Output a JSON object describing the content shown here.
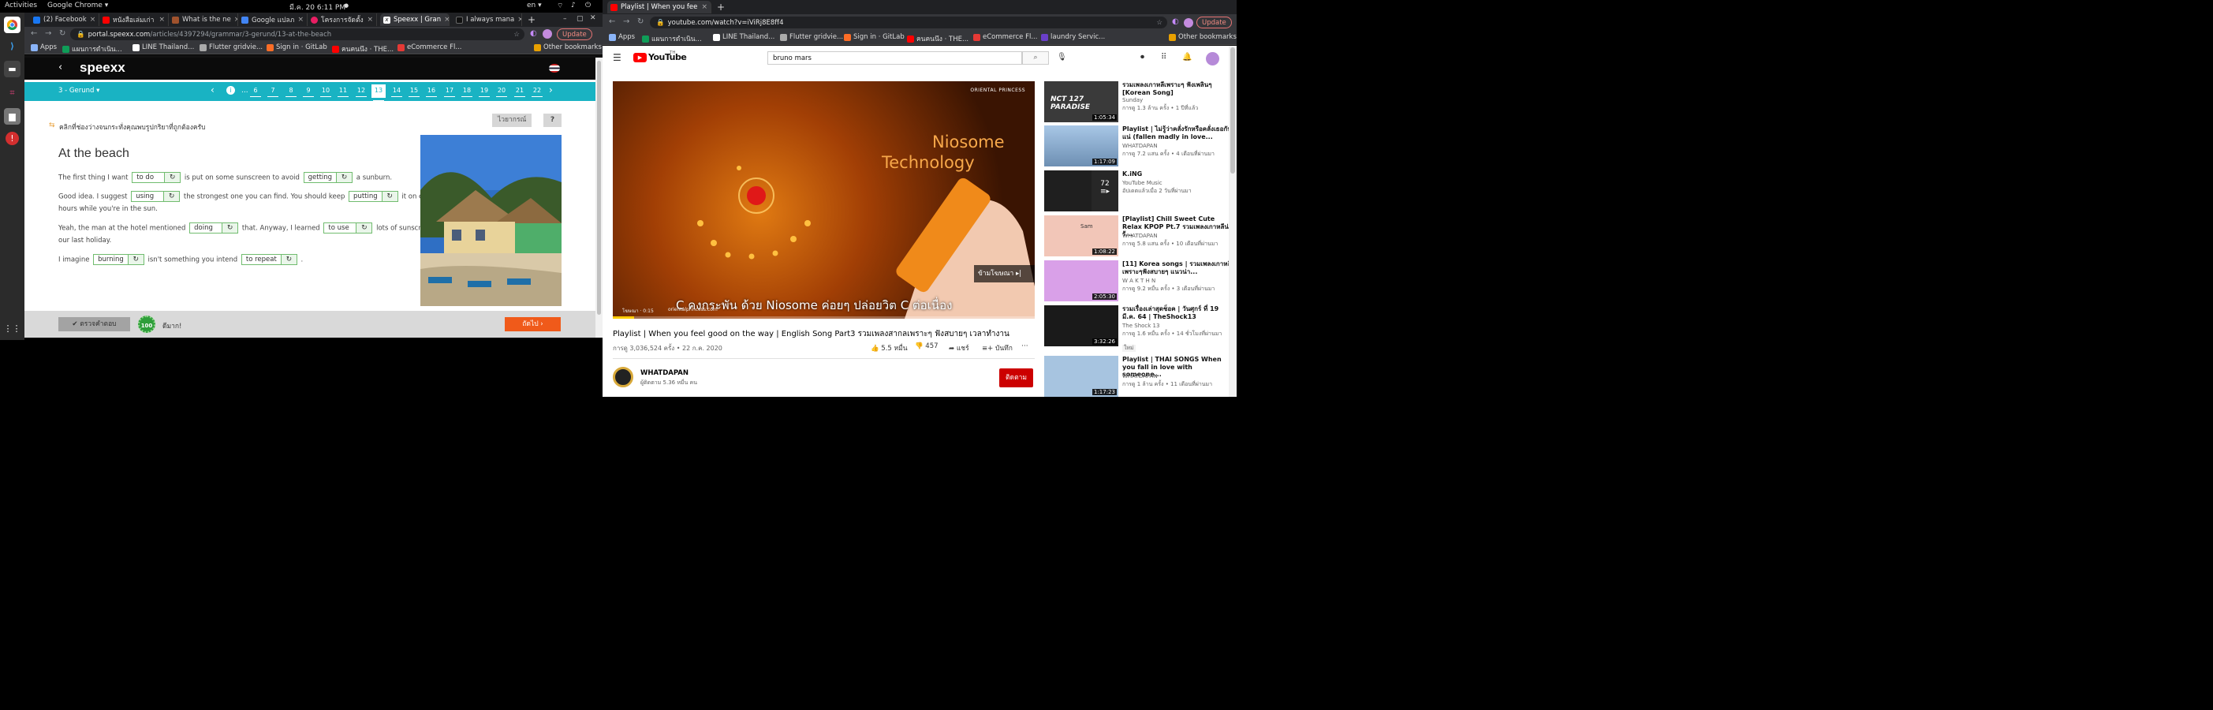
{
  "topbar": {
    "activities": "Activities",
    "app_menu": "Google Chrome ▾",
    "clock": "มี.ค. 20  6:11 PM",
    "dot": "●",
    "lang": "en ▾",
    "icons": [
      "network-icon",
      "volume-icon",
      "power-icon"
    ]
  },
  "left": {
    "tabs": [
      "(2) Facebook",
      "หนังสือเล่มเก่า",
      "What is the ne",
      "Google แปลภ",
      "โครงการจัดตั้ง",
      "Speexx | Gran",
      "I always mana"
    ],
    "url_host": "portal.speexx.com",
    "url_path": "/articles/4397294/grammar/3-gerund/13-at-the-beach",
    "update": "Update",
    "bookmarks": [
      "Apps",
      "แผนการดำเนิน...",
      "LINE Thailand...",
      "Flutter gridvie...",
      "Sign in · GitLab",
      "คนคนนึง · THE...",
      "eCommerce Fl..."
    ],
    "other_bookmarks": "Other bookmarks"
  },
  "speexx": {
    "logo": "speexx",
    "unit": "3 - Gerund",
    "pages": [
      "6",
      "7",
      "8",
      "9",
      "10",
      "11",
      "12",
      "13",
      "14",
      "15",
      "16",
      "17",
      "18",
      "19",
      "20",
      "21",
      "22"
    ],
    "current_page": "13",
    "ellipsis": "...",
    "instruction": "คลิกที่ช่องว่างจนกระทั่งคุณพบรูปกริยาที่ถูกต้องครับ",
    "grammar_btn": "ไวยากรณ์",
    "help_btn": "?",
    "title": "At the beach",
    "text": {
      "l1a": "The first thing I want",
      "g1": "to do",
      "l1b": "is put on some sunscreen to avoid",
      "g2": "getting",
      "l1c": "a sunburn.",
      "l2a": "Good idea.  I suggest",
      "g3": "using",
      "l2b": "the strongest one you can find. You should keep",
      "g4": "putting",
      "l2c": "it on every few",
      "l3": "hours while you're in the sun.",
      "l4a": "Yeah, the man at the hotel mentioned",
      "g5": "doing",
      "l4b": "that. Anyway, I learned",
      "g6": "to use",
      "l4c": "lots of sunscreen after",
      "l5": "our last holiday.",
      "l6a": "I imagine",
      "g7": "burning",
      "l6b": "isn't something you intend",
      "g8": "to repeat",
      "l6c": "."
    },
    "check_btn": "ตรวจคำตอบ",
    "score": "100",
    "score_text": "ดีมาก!",
    "next_btn": "ถัดไป"
  },
  "right": {
    "tab": "Playlist | When you fee",
    "url": "youtube.com/watch?v=iViRj8E8ff4",
    "update": "Update",
    "bookmarks": [
      "Apps",
      "แผนการดำเนิน...",
      "LINE Thailand...",
      "Flutter gridvie...",
      "Sign in · GitLab",
      "คนคนนึง · THE...",
      "eCommerce Fl...",
      "laundry Servic..."
    ],
    "other_bookmarks": "Other bookmarks"
  },
  "youtube": {
    "brand": "YouTube",
    "country": "TH",
    "search": "bruno mars",
    "ad": {
      "brand": "ORIENTAL PRINCESS",
      "headline1": "Niosome",
      "headline2": "Technology",
      "caption": "C คงกระพัน ด้วย Niosome ค่อยๆ ปล่อยวิต C ต่อเนื่อง",
      "skip": "ข้ามโฆษณา",
      "info": "โฆษณา · 0:15",
      "site": "orientalprincess.com",
      "progress": 0.05
    },
    "video_title": "Playlist | When you feel good on the way | English Song Part3 รวมเพลงสากลเพราะๆ ฟังสบายๆ เวลาทำงาน",
    "views": "การดู 3,036,524 ครั้ง • 22 ก.ค. 2020",
    "likes": "5.5 หมื่น",
    "dislikes": "457",
    "share": "แชร์",
    "save": "บันทึก",
    "channel": "WHATDAPAN",
    "subs": "ผู้ติดตาม 5.36 หมื่น คน",
    "subscribe": "ติดตาม",
    "suggestions": [
      {
        "title": "รวมเพลงเกาหลีเพราะๆ ฟังเพลินๆ [Korean Song]",
        "channel": "Sunday",
        "meta": "การดู 1.3 ล้าน ครั้ง • 1 ปีที่แล้ว",
        "duration": "1:05:34",
        "thumb_text": "NCT 127 PARADISE",
        "color": "#3a3a3a"
      },
      {
        "title": "Playlist | ไม่รู้ว่าคลั่งรักหรือคลั่งเธอกันแน่ (fallen madly in love...",
        "channel": "WHATDAPAN",
        "meta": "การดู 7.2 แสน ครั้ง • 4 เดือนที่ผ่านมา",
        "duration": "1:17:09",
        "thumb_text": "",
        "color": "#6d8fb3"
      },
      {
        "title": "K.iNG",
        "channel": "YouTube Music",
        "meta": "อัปเดตแล้วเมื่อ 2 วันที่ผ่านมา",
        "duration": "",
        "thumb_text": "",
        "color": "#1f1f1f",
        "count": "72"
      },
      {
        "title": "[Playlist] Chill Sweet Cute Relax KPOP Pt.7 รวมเพลงเกาหลีน่ารั...",
        "channel": "WHATDAPAN",
        "meta": "การดู 5.8 แสน ครั้ง • 10 เดือนที่ผ่านมา",
        "duration": "1:08:22",
        "thumb_text": "Sam",
        "color": "#f2c6b8"
      },
      {
        "title": "[11] Korea songs | รวมเพลงเกาหลีเพราะๆฟังสบายๆ แนวน่า...",
        "channel": "W A K T H N",
        "meta": "การดู 9.2 หมื่น ครั้ง • 3 เดือนที่ผ่านมา",
        "duration": "2:05:30",
        "thumb_text": "",
        "color": "#d9a0e8"
      },
      {
        "title": "รวมเรื่องเล่าสุดช็อค | วันศุกร์ ที่ 19 มี.ค. 64 | TheShock13",
        "channel": "The Shock 13",
        "meta": "การดู 1.6 หมื่น ครั้ง • 14 ชั่วโมงที่ผ่านมา",
        "badge": "ใหม่",
        "duration": "3:32:26",
        "thumb_text": "",
        "color": "#1a1a1a"
      },
      {
        "title": "Playlist | THAI SONGS When you fall in love with someone...",
        "channel": "WHATDAPAN",
        "meta": "การดู 1 ล้าน ครั้ง • 11 เดือนที่ผ่านมา",
        "duration": "1:17:23",
        "thumb_text": "",
        "color": "#a7c4e0"
      }
    ]
  }
}
